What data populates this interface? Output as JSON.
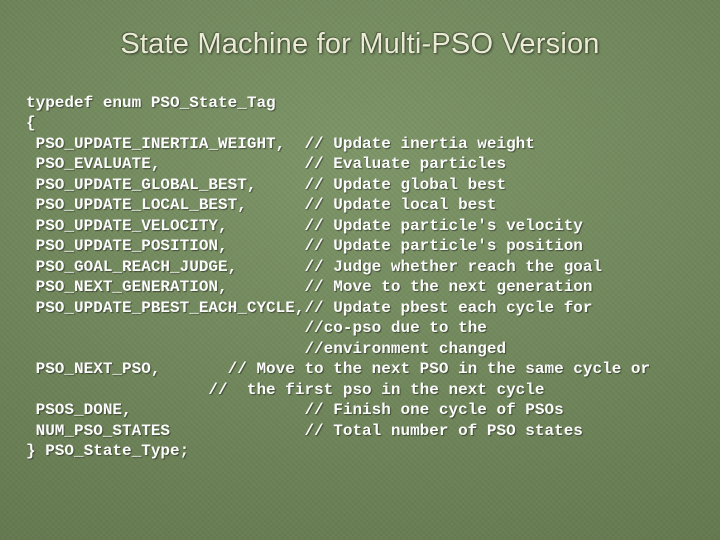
{
  "title": "State Machine for Multi-PSO Version",
  "code": "typedef enum PSO_State_Tag\n{\n PSO_UPDATE_INERTIA_WEIGHT,  // Update inertia weight\n PSO_EVALUATE,               // Evaluate particles\n PSO_UPDATE_GLOBAL_BEST,     // Update global best\n PSO_UPDATE_LOCAL_BEST,      // Update local best\n PSO_UPDATE_VELOCITY,        // Update particle's velocity\n PSO_UPDATE_POSITION,        // Update particle's position\n PSO_GOAL_REACH_JUDGE,       // Judge whether reach the goal\n PSO_NEXT_GENERATION,        // Move to the next generation\n PSO_UPDATE_PBEST_EACH_CYCLE,// Update pbest each cycle for\n                             //co-pso due to the\n                             //environment changed\n PSO_NEXT_PSO,       // Move to the next PSO in the same cycle or\n                   //  the first pso in the next cycle\n PSOS_DONE,                  // Finish one cycle of PSOs\n NUM_PSO_STATES              // Total number of PSO states\n} PSO_State_Type;"
}
